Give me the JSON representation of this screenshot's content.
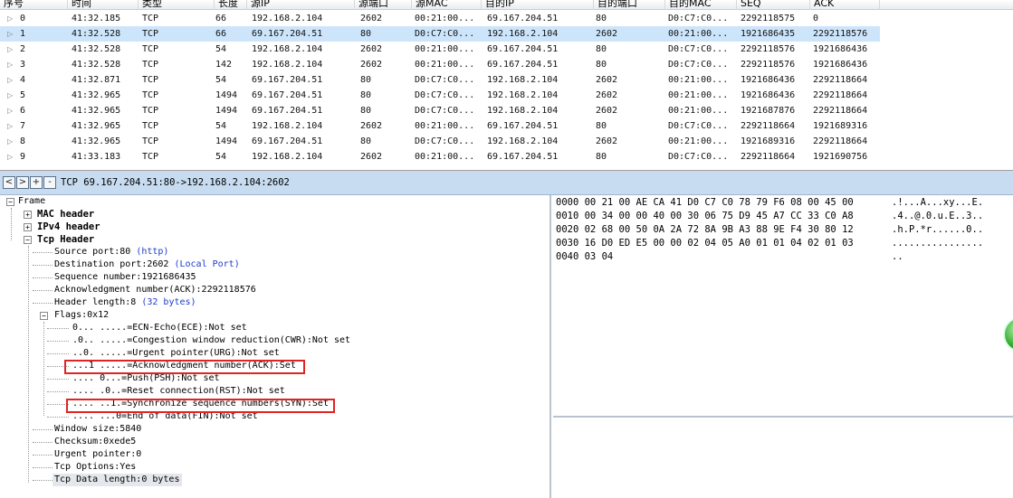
{
  "packet_list": {
    "columns": [
      "序号",
      "时间",
      "类型",
      "长度",
      "源IP",
      "源端口",
      "源MAC",
      "目的IP",
      "目的端口",
      "目的MAC",
      "SEQ",
      "ACK"
    ],
    "rows": [
      [
        "0",
        "41:32.185",
        "TCP",
        "66",
        "192.168.2.104",
        "2602",
        "00:21:00...",
        "69.167.204.51",
        "80",
        "D0:C7:C0...",
        "2292118575",
        "0"
      ],
      [
        "1",
        "41:32.528",
        "TCP",
        "66",
        "69.167.204.51",
        "80",
        "D0:C7:C0...",
        "192.168.2.104",
        "2602",
        "00:21:00...",
        "1921686435",
        "2292118576"
      ],
      [
        "2",
        "41:32.528",
        "TCP",
        "54",
        "192.168.2.104",
        "2602",
        "00:21:00...",
        "69.167.204.51",
        "80",
        "D0:C7:C0...",
        "2292118576",
        "1921686436"
      ],
      [
        "3",
        "41:32.528",
        "TCP",
        "142",
        "192.168.2.104",
        "2602",
        "00:21:00...",
        "69.167.204.51",
        "80",
        "D0:C7:C0...",
        "2292118576",
        "1921686436"
      ],
      [
        "4",
        "41:32.871",
        "TCP",
        "54",
        "69.167.204.51",
        "80",
        "D0:C7:C0...",
        "192.168.2.104",
        "2602",
        "00:21:00...",
        "1921686436",
        "2292118664"
      ],
      [
        "5",
        "41:32.965",
        "TCP",
        "1494",
        "69.167.204.51",
        "80",
        "D0:C7:C0...",
        "192.168.2.104",
        "2602",
        "00:21:00...",
        "1921686436",
        "2292118664"
      ],
      [
        "6",
        "41:32.965",
        "TCP",
        "1494",
        "69.167.204.51",
        "80",
        "D0:C7:C0...",
        "192.168.2.104",
        "2602",
        "00:21:00...",
        "1921687876",
        "2292118664"
      ],
      [
        "7",
        "41:32.965",
        "TCP",
        "54",
        "192.168.2.104",
        "2602",
        "00:21:00...",
        "69.167.204.51",
        "80",
        "D0:C7:C0...",
        "2292118664",
        "1921689316"
      ],
      [
        "8",
        "41:32.965",
        "TCP",
        "1494",
        "69.167.204.51",
        "80",
        "D0:C7:C0...",
        "192.168.2.104",
        "2602",
        "00:21:00...",
        "1921689316",
        "2292118664"
      ],
      [
        "9",
        "41:33.183",
        "TCP",
        "54",
        "192.168.2.104",
        "2602",
        "00:21:00...",
        "69.167.204.51",
        "80",
        "D0:C7:C0...",
        "2292118664",
        "1921690756"
      ]
    ],
    "selected_row": 1
  },
  "toolbar": {
    "buttons": [
      "<",
      ">",
      "+",
      "-"
    ],
    "summary": "TCP 69.167.204.51:80->192.168.2.104:2602"
  },
  "tree": {
    "frame": "Frame",
    "mac_header": "MAC header",
    "ipv4_header": "IPv4 header",
    "tcp_header": "Tcp Header",
    "source_port": "Source port:80",
    "source_port_note": "(http)",
    "dest_port": "Destination port:2602",
    "dest_port_note": "(Local Port)",
    "seq": "Sequence number:1921686435",
    "ack": "Acknowledgment number(ACK):2292118576",
    "header_length": "Header length:8",
    "header_length_note": "(32 bytes)",
    "flags": "Flags:0x12",
    "flag_items": [
      "0... .....=ECN-Echo(ECE):Not set",
      ".0.. .....=Congestion window reduction(CWR):Not set",
      "..0. .....=Urgent pointer(URG):Not set",
      "...1 .....=Acknowledgment number(ACK):Set",
      ".... 0...=Push(PSH):Not set",
      ".... .0..=Reset connection(RST):Not set",
      ".... ..1.=Synchronize sequence numbers(SYN):Set",
      ".... ...0=End of data(FIN):Not set"
    ],
    "window_size": "Window size:5840",
    "checksum": "Checksum:0xede5",
    "urgent_pointer": "Urgent pointer:0",
    "tcp_options": "Tcp Options:Yes",
    "tcp_data_length": "Tcp Data length:0 bytes"
  },
  "hex": {
    "lines": [
      "0000 00 21 00 AE CA 41 D0 C7 C0 78 79 F6 08 00 45 00",
      "0010 00 34 00 00 40 00 30 06 75 D9 45 A7 CC 33 C0 A8",
      "0020 02 68 00 50 0A 2A 72 8A 9B A3 88 9E F4 30 80 12",
      "0030 16 D0 ED E5 00 00 02 04 05 A0 01 01 04 02 01 03",
      "0040 03 04"
    ],
    "ascii": [
      ".!...A...xy...E.",
      ".4..@.0.u.E..3..",
      ".h.P.*r......0..",
      "................",
      ".."
    ]
  },
  "colors": {
    "selection": "#cde5fb",
    "toolbar": "#c7dcf0",
    "highlight_box": "#e02424",
    "link_blue": "#1c3cc8"
  }
}
